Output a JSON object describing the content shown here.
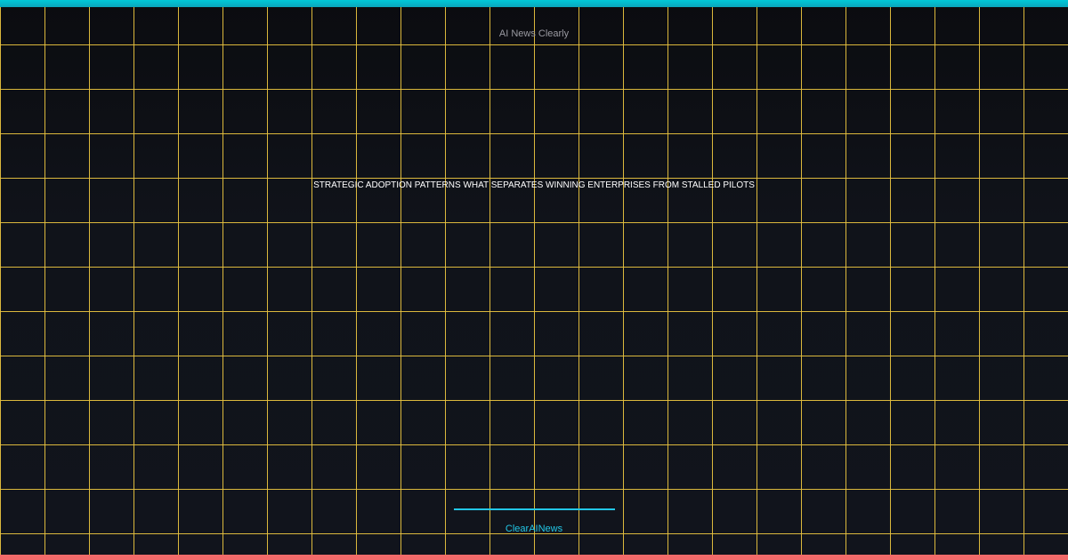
{
  "header": {
    "site_name": "AI News Clearly"
  },
  "article": {
    "headline": "STRATEGIC ADOPTION PATTERNS WHAT SEPARATES WINNING ENTERPRISES FROM STALLED PILOTS"
  },
  "footer": {
    "brand": "ClearAINews"
  },
  "colors": {
    "accent_top": "#00c8d8",
    "accent_bottom": "#f26a6a",
    "grid": "#e6c13f",
    "brand": "#22c7e6",
    "background": "#0f1118"
  }
}
